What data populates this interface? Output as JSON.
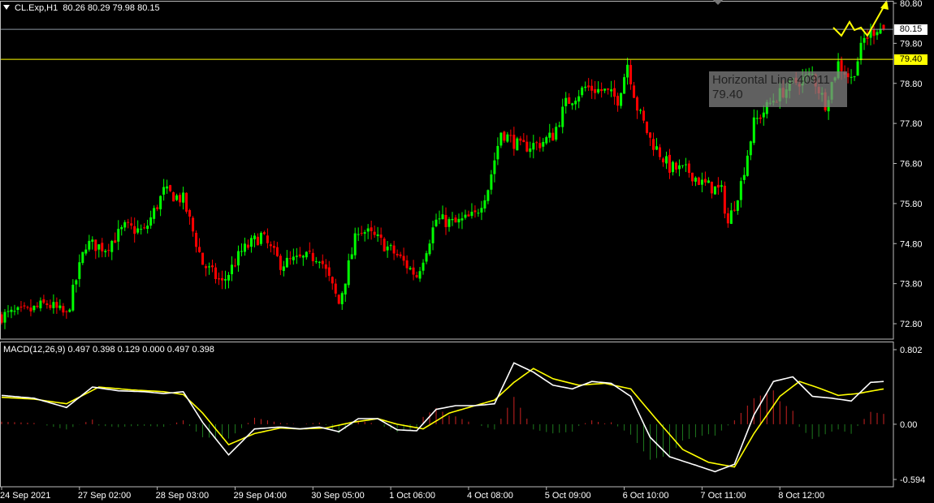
{
  "header": {
    "symbol": "CL.Exp,H1",
    "ohlc": "80.26 80.29 79.98 80.15"
  },
  "macd_header": "MACD(12,26,9) 0.497 0.398 0.129 0.000 0.497 0.398",
  "price_tags": {
    "bid": "80.15",
    "hline": "79.40"
  },
  "hline_label": {
    "line1": "Horizontal Line 40911",
    "line2": "79.40"
  },
  "colors": {
    "background": "#000000",
    "bull_candle": "#00ff00",
    "bear_candle": "#ff0000",
    "macd_line": "#ffffff",
    "signal_line": "#ffff00",
    "hist_pos": "#cc2222",
    "hist_neg": "#1e7a1e",
    "bid_line": "#8c96a0",
    "hline": "#ffff00",
    "arrow": "#ffff00"
  },
  "chart_data": [
    {
      "type": "candlestick",
      "symbol": "CL.Exp",
      "timeframe": "H1",
      "ylim": [
        72.3,
        80.8
      ],
      "y_ticks": [
        "80.80",
        "79.80",
        "78.80",
        "77.80",
        "76.80",
        "75.80",
        "74.80",
        "73.80",
        "72.80"
      ],
      "x_ticks": [
        "24 Sep 2021",
        "27 Sep 02:00",
        "28 Sep 03:00",
        "29 Sep 04:00",
        "30 Sep 05:00",
        "1 Oct 06:00",
        "4 Oct 08:00",
        "5 Oct 09:00",
        "6 Oct 10:00",
        "7 Oct 11:00",
        "8 Oct 12:00"
      ],
      "close_path": [
        [
          0,
          73.0
        ],
        [
          8,
          73.1
        ],
        [
          14,
          73.3
        ],
        [
          20,
          73.0
        ],
        [
          26,
          74.8
        ],
        [
          32,
          74.7
        ],
        [
          38,
          75.2
        ],
        [
          44,
          75.1
        ],
        [
          50,
          76.1
        ],
        [
          56,
          75.9
        ],
        [
          62,
          74.3
        ],
        [
          68,
          73.8
        ],
        [
          74,
          74.6
        ],
        [
          80,
          75.0
        ],
        [
          86,
          74.3
        ],
        [
          92,
          74.4
        ],
        [
          98,
          74.5
        ],
        [
          104,
          73.3
        ],
        [
          110,
          75.2
        ],
        [
          116,
          74.9
        ],
        [
          122,
          74.5
        ],
        [
          128,
          74.0
        ],
        [
          134,
          75.4
        ],
        [
          140,
          75.3
        ],
        [
          146,
          75.5
        ],
        [
          150,
          76.2
        ],
        [
          154,
          77.6
        ],
        [
          160,
          77.2
        ],
        [
          166,
          77.3
        ],
        [
          170,
          77.5
        ],
        [
          174,
          78.3
        ],
        [
          180,
          78.7
        ],
        [
          186,
          78.6
        ],
        [
          190,
          78.4
        ],
        [
          193,
          79.3
        ],
        [
          196,
          78.2
        ],
        [
          200,
          77.4
        ],
        [
          206,
          76.7
        ],
        [
          212,
          76.6
        ],
        [
          216,
          76.3
        ],
        [
          222,
          76.1
        ],
        [
          224,
          75.3
        ],
        [
          228,
          76.3
        ],
        [
          232,
          77.8
        ],
        [
          238,
          78.4
        ],
        [
          244,
          78.8
        ],
        [
          250,
          79.0
        ],
        [
          254,
          78.3
        ],
        [
          258,
          79.3
        ],
        [
          262,
          78.9
        ],
        [
          266,
          79.9
        ],
        [
          270,
          80.2
        ],
        [
          272,
          80.15
        ]
      ],
      "horizontal_lines": [
        79.4
      ],
      "bid": 80.15,
      "last_bar": {
        "open": 80.26,
        "high": 80.29,
        "low": 79.98,
        "close": 80.15
      }
    },
    {
      "type": "line",
      "title": "MACD(12,26,9)",
      "ylim": [
        -0.594,
        0.802
      ],
      "y_ticks": [
        "0.802",
        "0.00",
        "-0.594"
      ],
      "series": [
        {
          "name": "MACD",
          "values": [
            [
              0,
              0.31
            ],
            [
              10,
              0.28
            ],
            [
              20,
              0.18
            ],
            [
              28,
              0.4
            ],
            [
              36,
              0.36
            ],
            [
              44,
              0.35
            ],
            [
              50,
              0.33
            ],
            [
              56,
              0.35
            ],
            [
              62,
              0.02
            ],
            [
              70,
              -0.33
            ],
            [
              78,
              -0.05
            ],
            [
              86,
              -0.03
            ],
            [
              92,
              -0.05
            ],
            [
              98,
              -0.03
            ],
            [
              104,
              -0.08
            ],
            [
              110,
              0.06
            ],
            [
              116,
              0.06
            ],
            [
              122,
              -0.06
            ],
            [
              128,
              -0.07
            ],
            [
              134,
              0.16
            ],
            [
              140,
              0.2
            ],
            [
              146,
              0.2
            ],
            [
              152,
              0.22
            ],
            [
              158,
              0.66
            ],
            [
              164,
              0.56
            ],
            [
              170,
              0.42
            ],
            [
              176,
              0.38
            ],
            [
              182,
              0.46
            ],
            [
              188,
              0.44
            ],
            [
              194,
              0.3
            ],
            [
              200,
              -0.14
            ],
            [
              206,
              -0.35
            ],
            [
              214,
              -0.44
            ],
            [
              220,
              -0.51
            ],
            [
              226,
              -0.43
            ],
            [
              232,
              0.1
            ],
            [
              238,
              0.46
            ],
            [
              244,
              0.51
            ],
            [
              250,
              0.3
            ],
            [
              256,
              0.28
            ],
            [
              262,
              0.25
            ],
            [
              268,
              0.45
            ],
            [
              272,
              0.46
            ]
          ]
        },
        {
          "name": "Signal",
          "values": [
            [
              0,
              0.29
            ],
            [
              10,
              0.27
            ],
            [
              20,
              0.22
            ],
            [
              30,
              0.4
            ],
            [
              40,
              0.37
            ],
            [
              50,
              0.35
            ],
            [
              56,
              0.32
            ],
            [
              62,
              0.12
            ],
            [
              70,
              -0.22
            ],
            [
              78,
              -0.1
            ],
            [
              86,
              -0.04
            ],
            [
              92,
              -0.05
            ],
            [
              100,
              -0.04
            ],
            [
              108,
              0.02
            ],
            [
              116,
              0.06
            ],
            [
              122,
              0.0
            ],
            [
              130,
              -0.05
            ],
            [
              138,
              0.12
            ],
            [
              146,
              0.2
            ],
            [
              152,
              0.26
            ],
            [
              158,
              0.45
            ],
            [
              164,
              0.6
            ],
            [
              170,
              0.49
            ],
            [
              178,
              0.42
            ],
            [
              186,
              0.44
            ],
            [
              194,
              0.38
            ],
            [
              202,
              0.05
            ],
            [
              210,
              -0.27
            ],
            [
              218,
              -0.41
            ],
            [
              226,
              -0.46
            ],
            [
              232,
              -0.1
            ],
            [
              240,
              0.3
            ],
            [
              246,
              0.46
            ],
            [
              252,
              0.39
            ],
            [
              258,
              0.31
            ],
            [
              264,
              0.33
            ],
            [
              272,
              0.38
            ]
          ]
        }
      ]
    }
  ]
}
